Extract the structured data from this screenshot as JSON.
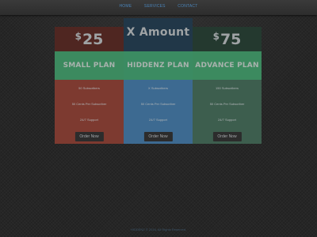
{
  "nav": {
    "items": [
      {
        "label": "HOME"
      },
      {
        "label": "SERVICES"
      },
      {
        "label": "CONTACT"
      }
    ]
  },
  "plans": [
    {
      "currency": "$",
      "price": "25",
      "name": "SMALL PLAN",
      "features": [
        "50 Subscribers",
        "50 Cents Per Subscriber",
        "24/7 Support"
      ],
      "button": "Order Now",
      "colors": {
        "header": "#4f2621",
        "banner": "#3c8a5f",
        "body": "#7d3a30"
      }
    },
    {
      "price_text": "X Amount",
      "name": "HIDDENZ PLAN",
      "features": [
        "X Subscribers",
        "50 Cents Per Subscriber",
        "24/7 Support"
      ],
      "button": "Order Now",
      "colors": {
        "header": "#213748",
        "banner": "#3b8b62",
        "body": "#3d6a91"
      }
    },
    {
      "currency": "$",
      "price": "75",
      "name": "ADVANCE PLAN",
      "features": [
        "150 Subscribers",
        "50 Cents Per Subscriber",
        "24/7 Support"
      ],
      "button": "Order Now",
      "colors": {
        "header": "#24392f",
        "banner": "#3c8a5f",
        "body": "#3d5e4e"
      }
    }
  ],
  "footer": {
    "text": "HIDDENZ © 2016. All Rights Reserved."
  }
}
